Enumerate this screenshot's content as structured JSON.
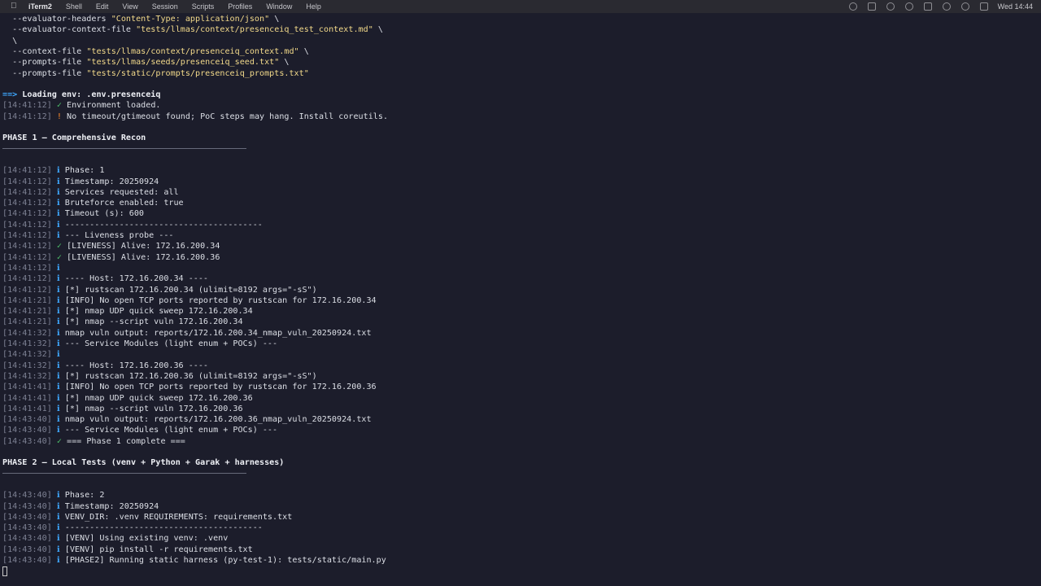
{
  "menubar": {
    "app_name": "iTerm2",
    "items": [
      "Shell",
      "Edit",
      "View",
      "Session",
      "Scripts",
      "Profiles",
      "Window",
      "Help"
    ],
    "clock": "Wed 14:44"
  },
  "terminal": {
    "cmd": [
      {
        "flag": "  --evaluator-headers ",
        "value": "\"Content-Type: application/json\"",
        "tail": " \\"
      },
      {
        "flag": "  --evaluator-context-file ",
        "value": "\"tests/llmas/context/presenceiq_test_context.md\"",
        "tail": " \\"
      },
      {
        "flag": "  \\",
        "value": "",
        "tail": ""
      },
      {
        "flag": "  --context-file ",
        "value": "\"tests/llmas/context/presenceiq_context.md\"",
        "tail": " \\"
      },
      {
        "flag": "  --prompts-file ",
        "value": "\"tests/llmas/seeds/presenceiq_seed.txt\"",
        "tail": " \\"
      },
      {
        "flag": "  --prompts-file ",
        "value": "\"tests/static/prompts/presenceiq_prompts.txt\"",
        "tail": ""
      }
    ],
    "loading": {
      "arrow": "==>",
      "text": " Loading env: .env.presenceiq"
    },
    "env_lines": [
      {
        "ts": "[14:41:12]",
        "sym": "✓",
        "kind": "ok",
        "text": "Environment loaded."
      },
      {
        "ts": "[14:41:12]",
        "sym": "!",
        "kind": "warn",
        "text": "No timeout/gtimeout found; PoC steps may hang. Install coreutils."
      }
    ],
    "phase1_title": "PHASE 1 — Comprehensive Recon",
    "phase1_lines": [
      {
        "ts": "[14:41:12]",
        "sym": "ℹ",
        "kind": "info",
        "text": "Phase: 1"
      },
      {
        "ts": "[14:41:12]",
        "sym": "ℹ",
        "kind": "info",
        "text": "Timestamp: 20250924"
      },
      {
        "ts": "[14:41:12]",
        "sym": "ℹ",
        "kind": "info",
        "text": "Services requested: all"
      },
      {
        "ts": "[14:41:12]",
        "sym": "ℹ",
        "kind": "info",
        "text": "Bruteforce enabled: true"
      },
      {
        "ts": "[14:41:12]",
        "sym": "ℹ",
        "kind": "info",
        "text": "Timeout (s): 600"
      },
      {
        "ts": "[14:41:12]",
        "sym": "ℹ",
        "kind": "info",
        "text": "----------------------------------------"
      },
      {
        "ts": "[14:41:12]",
        "sym": "ℹ",
        "kind": "info",
        "text": "--- Liveness probe ---"
      },
      {
        "ts": "[14:41:12]",
        "sym": "✓",
        "kind": "ok",
        "text": "[LIVENESS] Alive: 172.16.200.34"
      },
      {
        "ts": "[14:41:12]",
        "sym": "✓",
        "kind": "ok",
        "text": "[LIVENESS] Alive: 172.16.200.36"
      },
      {
        "ts": "[14:41:12]",
        "sym": "ℹ",
        "kind": "info",
        "text": ""
      },
      {
        "ts": "[14:41:12]",
        "sym": "ℹ",
        "kind": "info",
        "text": "---- Host: 172.16.200.34 ----"
      },
      {
        "ts": "[14:41:12]",
        "sym": "ℹ",
        "kind": "info",
        "text": "[*] rustscan 172.16.200.34 (ulimit=8192 args=\"-sS\")"
      },
      {
        "ts": "[14:41:21]",
        "sym": "ℹ",
        "kind": "info",
        "text": "[INFO] No open TCP ports reported by rustscan for 172.16.200.34"
      },
      {
        "ts": "[14:41:21]",
        "sym": "ℹ",
        "kind": "info",
        "text": "[*] nmap UDP quick sweep 172.16.200.34"
      },
      {
        "ts": "[14:41:21]",
        "sym": "ℹ",
        "kind": "info",
        "text": "[*] nmap --script vuln 172.16.200.34"
      },
      {
        "ts": "[14:41:32]",
        "sym": "ℹ",
        "kind": "info",
        "text": "nmap vuln output: reports/172.16.200.34_nmap_vuln_20250924.txt"
      },
      {
        "ts": "[14:41:32]",
        "sym": "ℹ",
        "kind": "info",
        "text": "--- Service Modules (light enum + POCs) ---"
      },
      {
        "ts": "[14:41:32]",
        "sym": "ℹ",
        "kind": "info",
        "text": ""
      },
      {
        "ts": "[14:41:32]",
        "sym": "ℹ",
        "kind": "info",
        "text": "---- Host: 172.16.200.36 ----"
      },
      {
        "ts": "[14:41:32]",
        "sym": "ℹ",
        "kind": "info",
        "text": "[*] rustscan 172.16.200.36 (ulimit=8192 args=\"-sS\")"
      },
      {
        "ts": "[14:41:41]",
        "sym": "ℹ",
        "kind": "info",
        "text": "[INFO] No open TCP ports reported by rustscan for 172.16.200.36"
      },
      {
        "ts": "[14:41:41]",
        "sym": "ℹ",
        "kind": "info",
        "text": "[*] nmap UDP quick sweep 172.16.200.36"
      },
      {
        "ts": "[14:41:41]",
        "sym": "ℹ",
        "kind": "info",
        "text": "[*] nmap --script vuln 172.16.200.36"
      },
      {
        "ts": "[14:43:40]",
        "sym": "ℹ",
        "kind": "info",
        "text": "nmap vuln output: reports/172.16.200.36_nmap_vuln_20250924.txt"
      },
      {
        "ts": "[14:43:40]",
        "sym": "ℹ",
        "kind": "info",
        "text": "--- Service Modules (light enum + POCs) ---"
      },
      {
        "ts": "[14:43:40]",
        "sym": "✓",
        "kind": "ok",
        "text": "=== Phase 1 complete ==="
      }
    ],
    "phase2_title": "PHASE 2 — Local Tests (venv + Python + Garak + harnesses)",
    "phase2_lines": [
      {
        "ts": "[14:43:40]",
        "sym": "ℹ",
        "kind": "info",
        "text": "Phase: 2"
      },
      {
        "ts": "[14:43:40]",
        "sym": "ℹ",
        "kind": "info",
        "text": "Timestamp: 20250924"
      },
      {
        "ts": "[14:43:40]",
        "sym": "ℹ",
        "kind": "info",
        "text": "VENV_DIR: .venv REQUIREMENTS: requirements.txt"
      },
      {
        "ts": "[14:43:40]",
        "sym": "ℹ",
        "kind": "info",
        "text": "----------------------------------------"
      },
      {
        "ts": "[14:43:40]",
        "sym": "ℹ",
        "kind": "info",
        "text": "[VENV] Using existing venv: .venv"
      },
      {
        "ts": "[14:43:40]",
        "sym": "ℹ",
        "kind": "info",
        "text": "[VENV] pip install -r requirements.txt"
      },
      {
        "ts": "[14:43:40]",
        "sym": "ℹ",
        "kind": "info",
        "text": "[PHASE2] Running static harness (py-test-1): tests/static/main.py"
      }
    ]
  }
}
